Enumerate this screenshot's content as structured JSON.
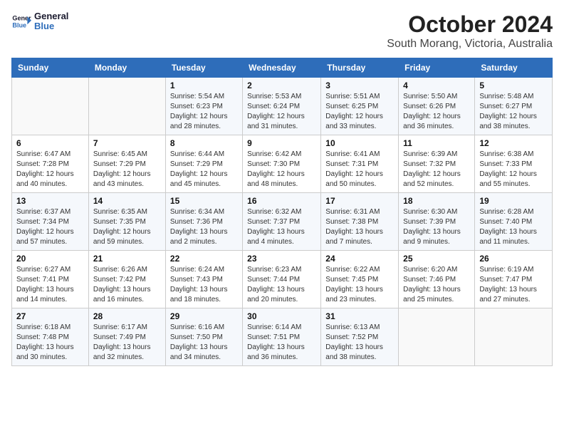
{
  "logo": {
    "line1": "General",
    "line2": "Blue"
  },
  "title": "October 2024",
  "subtitle": "South Morang, Victoria, Australia",
  "days_header": [
    "Sunday",
    "Monday",
    "Tuesday",
    "Wednesday",
    "Thursday",
    "Friday",
    "Saturday"
  ],
  "weeks": [
    [
      {
        "day": "",
        "sunrise": "",
        "sunset": "",
        "daylight": ""
      },
      {
        "day": "",
        "sunrise": "",
        "sunset": "",
        "daylight": ""
      },
      {
        "day": "1",
        "sunrise": "Sunrise: 5:54 AM",
        "sunset": "Sunset: 6:23 PM",
        "daylight": "Daylight: 12 hours and 28 minutes."
      },
      {
        "day": "2",
        "sunrise": "Sunrise: 5:53 AM",
        "sunset": "Sunset: 6:24 PM",
        "daylight": "Daylight: 12 hours and 31 minutes."
      },
      {
        "day": "3",
        "sunrise": "Sunrise: 5:51 AM",
        "sunset": "Sunset: 6:25 PM",
        "daylight": "Daylight: 12 hours and 33 minutes."
      },
      {
        "day": "4",
        "sunrise": "Sunrise: 5:50 AM",
        "sunset": "Sunset: 6:26 PM",
        "daylight": "Daylight: 12 hours and 36 minutes."
      },
      {
        "day": "5",
        "sunrise": "Sunrise: 5:48 AM",
        "sunset": "Sunset: 6:27 PM",
        "daylight": "Daylight: 12 hours and 38 minutes."
      }
    ],
    [
      {
        "day": "6",
        "sunrise": "Sunrise: 6:47 AM",
        "sunset": "Sunset: 7:28 PM",
        "daylight": "Daylight: 12 hours and 40 minutes."
      },
      {
        "day": "7",
        "sunrise": "Sunrise: 6:45 AM",
        "sunset": "Sunset: 7:29 PM",
        "daylight": "Daylight: 12 hours and 43 minutes."
      },
      {
        "day": "8",
        "sunrise": "Sunrise: 6:44 AM",
        "sunset": "Sunset: 7:29 PM",
        "daylight": "Daylight: 12 hours and 45 minutes."
      },
      {
        "day": "9",
        "sunrise": "Sunrise: 6:42 AM",
        "sunset": "Sunset: 7:30 PM",
        "daylight": "Daylight: 12 hours and 48 minutes."
      },
      {
        "day": "10",
        "sunrise": "Sunrise: 6:41 AM",
        "sunset": "Sunset: 7:31 PM",
        "daylight": "Daylight: 12 hours and 50 minutes."
      },
      {
        "day": "11",
        "sunrise": "Sunrise: 6:39 AM",
        "sunset": "Sunset: 7:32 PM",
        "daylight": "Daylight: 12 hours and 52 minutes."
      },
      {
        "day": "12",
        "sunrise": "Sunrise: 6:38 AM",
        "sunset": "Sunset: 7:33 PM",
        "daylight": "Daylight: 12 hours and 55 minutes."
      }
    ],
    [
      {
        "day": "13",
        "sunrise": "Sunrise: 6:37 AM",
        "sunset": "Sunset: 7:34 PM",
        "daylight": "Daylight: 12 hours and 57 minutes."
      },
      {
        "day": "14",
        "sunrise": "Sunrise: 6:35 AM",
        "sunset": "Sunset: 7:35 PM",
        "daylight": "Daylight: 12 hours and 59 minutes."
      },
      {
        "day": "15",
        "sunrise": "Sunrise: 6:34 AM",
        "sunset": "Sunset: 7:36 PM",
        "daylight": "Daylight: 13 hours and 2 minutes."
      },
      {
        "day": "16",
        "sunrise": "Sunrise: 6:32 AM",
        "sunset": "Sunset: 7:37 PM",
        "daylight": "Daylight: 13 hours and 4 minutes."
      },
      {
        "day": "17",
        "sunrise": "Sunrise: 6:31 AM",
        "sunset": "Sunset: 7:38 PM",
        "daylight": "Daylight: 13 hours and 7 minutes."
      },
      {
        "day": "18",
        "sunrise": "Sunrise: 6:30 AM",
        "sunset": "Sunset: 7:39 PM",
        "daylight": "Daylight: 13 hours and 9 minutes."
      },
      {
        "day": "19",
        "sunrise": "Sunrise: 6:28 AM",
        "sunset": "Sunset: 7:40 PM",
        "daylight": "Daylight: 13 hours and 11 minutes."
      }
    ],
    [
      {
        "day": "20",
        "sunrise": "Sunrise: 6:27 AM",
        "sunset": "Sunset: 7:41 PM",
        "daylight": "Daylight: 13 hours and 14 minutes."
      },
      {
        "day": "21",
        "sunrise": "Sunrise: 6:26 AM",
        "sunset": "Sunset: 7:42 PM",
        "daylight": "Daylight: 13 hours and 16 minutes."
      },
      {
        "day": "22",
        "sunrise": "Sunrise: 6:24 AM",
        "sunset": "Sunset: 7:43 PM",
        "daylight": "Daylight: 13 hours and 18 minutes."
      },
      {
        "day": "23",
        "sunrise": "Sunrise: 6:23 AM",
        "sunset": "Sunset: 7:44 PM",
        "daylight": "Daylight: 13 hours and 20 minutes."
      },
      {
        "day": "24",
        "sunrise": "Sunrise: 6:22 AM",
        "sunset": "Sunset: 7:45 PM",
        "daylight": "Daylight: 13 hours and 23 minutes."
      },
      {
        "day": "25",
        "sunrise": "Sunrise: 6:20 AM",
        "sunset": "Sunset: 7:46 PM",
        "daylight": "Daylight: 13 hours and 25 minutes."
      },
      {
        "day": "26",
        "sunrise": "Sunrise: 6:19 AM",
        "sunset": "Sunset: 7:47 PM",
        "daylight": "Daylight: 13 hours and 27 minutes."
      }
    ],
    [
      {
        "day": "27",
        "sunrise": "Sunrise: 6:18 AM",
        "sunset": "Sunset: 7:48 PM",
        "daylight": "Daylight: 13 hours and 30 minutes."
      },
      {
        "day": "28",
        "sunrise": "Sunrise: 6:17 AM",
        "sunset": "Sunset: 7:49 PM",
        "daylight": "Daylight: 13 hours and 32 minutes."
      },
      {
        "day": "29",
        "sunrise": "Sunrise: 6:16 AM",
        "sunset": "Sunset: 7:50 PM",
        "daylight": "Daylight: 13 hours and 34 minutes."
      },
      {
        "day": "30",
        "sunrise": "Sunrise: 6:14 AM",
        "sunset": "Sunset: 7:51 PM",
        "daylight": "Daylight: 13 hours and 36 minutes."
      },
      {
        "day": "31",
        "sunrise": "Sunrise: 6:13 AM",
        "sunset": "Sunset: 7:52 PM",
        "daylight": "Daylight: 13 hours and 38 minutes."
      },
      {
        "day": "",
        "sunrise": "",
        "sunset": "",
        "daylight": ""
      },
      {
        "day": "",
        "sunrise": "",
        "sunset": "",
        "daylight": ""
      }
    ]
  ]
}
